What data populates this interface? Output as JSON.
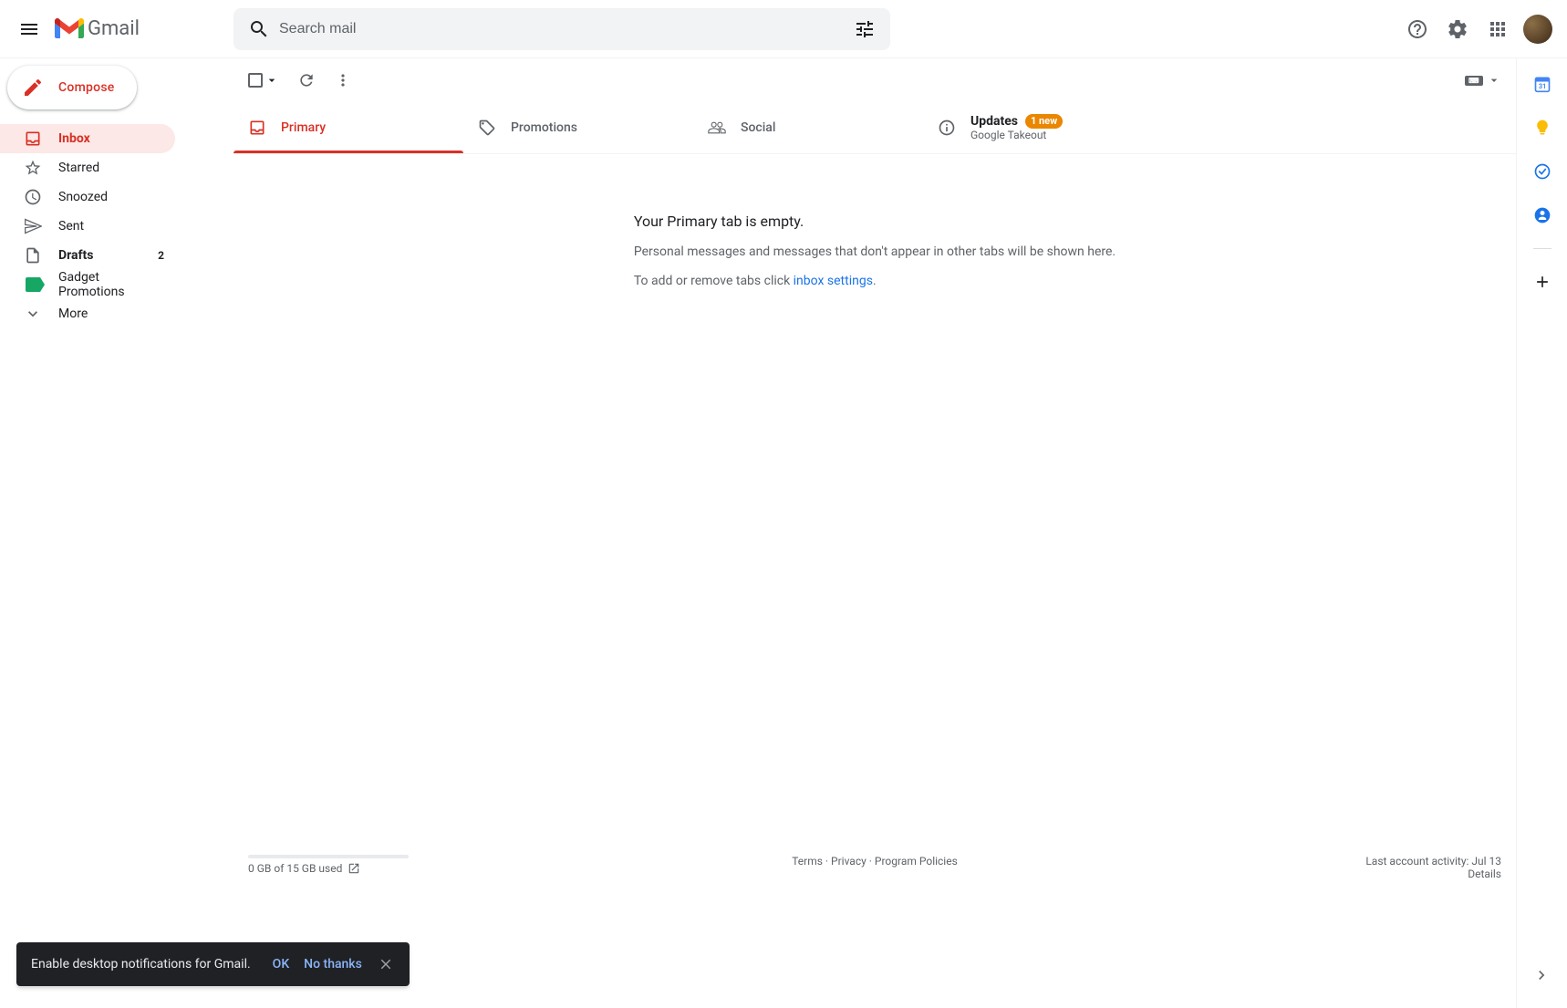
{
  "header": {
    "app_name": "Gmail",
    "search_placeholder": "Search mail"
  },
  "compose_label": "Compose",
  "sidebar": {
    "items": [
      {
        "label": "Inbox",
        "count": ""
      },
      {
        "label": "Starred",
        "count": ""
      },
      {
        "label": "Snoozed",
        "count": ""
      },
      {
        "label": "Sent",
        "count": ""
      },
      {
        "label": "Drafts",
        "count": "2"
      },
      {
        "label": "Gadget Promotions",
        "count": ""
      },
      {
        "label": "More",
        "count": ""
      }
    ]
  },
  "toolbar": {
    "input_tool_label": ""
  },
  "tabs": {
    "primary": {
      "label": "Primary"
    },
    "promotions": {
      "label": "Promotions"
    },
    "social": {
      "label": "Social"
    },
    "updates": {
      "label": "Updates",
      "badge": "1 new",
      "sub": "Google Takeout"
    }
  },
  "empty": {
    "title": "Your Primary tab is empty.",
    "line1": "Personal messages and messages that don't appear in other tabs will be shown here.",
    "line2_pre": "To add or remove tabs click ",
    "link": "inbox settings",
    "line2_post": "."
  },
  "footer": {
    "storage": "0 GB of 15 GB used",
    "terms": "Terms",
    "privacy": "Privacy",
    "policies": "Program Policies",
    "activity": "Last account activity: Jul 13",
    "details": "Details"
  },
  "toast": {
    "text": "Enable desktop notifications for Gmail.",
    "ok": "OK",
    "no": "No thanks"
  }
}
